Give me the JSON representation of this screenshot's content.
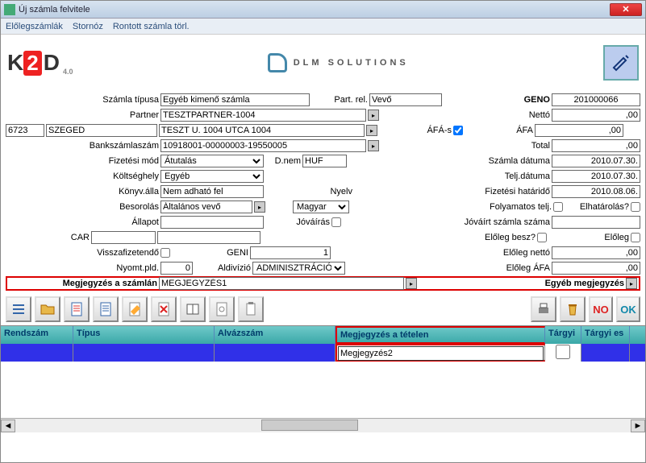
{
  "window": {
    "title": "Új számla felvitele"
  },
  "menu": {
    "item1": "Előlegszámlák",
    "item2": "Stornóz",
    "item3": "Rontott számla törl."
  },
  "logo": {
    "brand": "DLM SOLUTIONS",
    "k2d_ver": "4.0"
  },
  "labels": {
    "szamla_tipusa": "Számla típusa",
    "part_rel": "Part. rel.",
    "geno": "GENO",
    "partner": "Partner",
    "netto": "Nettó",
    "afas": "ÁFÁ-s",
    "afa": "ÁFA",
    "bankszamlaszam": "Bankszámlaszám",
    "total": "Total",
    "fizetesi_mod": "Fizetési mód",
    "dnem": "D.nem",
    "szamla_datuma": "Számla dátuma",
    "koltseghely": "Költséghely",
    "telj_datuma": "Telj.dátuma",
    "konyv_alla": "Könyv.álla",
    "nyelv": "Nyelv",
    "fiz_hatarido": "Fizetési határidő",
    "besorolas": "Besorolás",
    "folyamatos_telj": "Folyamatos telj.",
    "elhatarolas": "Elhatárolás?",
    "allapot": "Állapot",
    "jovairas": "Jóváírás",
    "jovairt_szamla": "Jóváírt számla száma",
    "car": "CAR",
    "eloleg_besz": "Előleg besz?",
    "eloleg": "Előleg",
    "visszafizetendo": "Visszafizetendő",
    "geni": "GENI",
    "eloleg_netto": "Előleg nettó",
    "nyomt_pld": "Nyomt.pld.",
    "aldivizio": "Aldivízió",
    "eloleg_afa": "Előleg ÁFA",
    "megjegyzes_szamlan": "Megjegyzés a számlán",
    "egyeb_megjegyzes": "Egyéb megjegyzés"
  },
  "values": {
    "szamla_tipusa": "Egyéb kimenő számla",
    "part_rel": "Vevő",
    "geno": "201000066",
    "partner": "TESZTPARTNER-1004",
    "netto": ",00",
    "irsz": "6723",
    "varos": "SZEGED",
    "cim": "TESZT U. 1004 UTCA 1004",
    "afas_checked": true,
    "afa": ",00",
    "bankszamlaszam": "10918001-00000003-19550005",
    "total": ",00",
    "fizetesi_mod": "Átutalás",
    "dnem": "HUF",
    "szamla_datuma": "2010.07.30.",
    "koltseghely": "Egyéb",
    "telj_datuma": "2010.07.30.",
    "konyv_alla": "Nem adható fel",
    "fiz_hatarido": "2010.08.06.",
    "besorolas": "Általános vevő",
    "nyelv": "Magyar",
    "allapot": "",
    "jovairt_szamla": "",
    "car": "",
    "geni": "1",
    "eloleg_netto": ",00",
    "nyomt_pld": "0",
    "aldivizio": "ADMINISZTRÁCIÓ",
    "eloleg_afa": ",00",
    "megjegyzes": "MEGJEGYZÉS1"
  },
  "grid": {
    "headers": {
      "rendszam": "Rendszám",
      "tipus": "Típus",
      "alvazszam": "Alvázszám",
      "megjegyzes_tetel": "Megjegyzés a tételen",
      "targyi": "Tárgyi",
      "targyi_es": "Tárgyi es"
    },
    "row": {
      "megjegyzes": "Megjegyzés2"
    }
  },
  "buttons": {
    "no": "NO",
    "ok": "OK"
  }
}
